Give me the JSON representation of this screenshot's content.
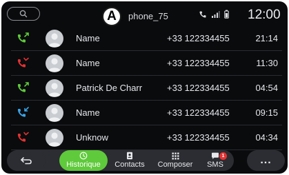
{
  "header": {
    "badge": "A",
    "device_name": "phone_75",
    "time": "12:00"
  },
  "calls": [
    {
      "type": "outgoing",
      "name": "Name",
      "number": "+33 122334455",
      "time": "21:14"
    },
    {
      "type": "missed",
      "name": "Name",
      "number": "+33 122334455",
      "time": "11:30"
    },
    {
      "type": "outgoing",
      "name": "Patrick De Charr",
      "number": "+33 122334455",
      "time": "04:54"
    },
    {
      "type": "incoming",
      "name": "Name",
      "number": "+33 122334455",
      "time": "09:15"
    },
    {
      "type": "missed",
      "name": "Unknow",
      "number": "+33 122334455",
      "time": "04:34"
    }
  ],
  "call_type_colors": {
    "outgoing": "#5fca3b",
    "missed": "#e53232",
    "incoming": "#3aa3e6"
  },
  "nav": {
    "tabs": [
      {
        "label": "Historique",
        "icon": "clock-icon",
        "active": true
      },
      {
        "label": "Contacts",
        "icon": "contacts-book-icon",
        "active": false
      },
      {
        "label": "Composer",
        "icon": "dialpad-icon",
        "active": false
      },
      {
        "label": "SMS",
        "icon": "sms-bubble-icon",
        "active": false
      }
    ],
    "sms_badge": "1",
    "more_label": "...",
    "accent": "#5fca3b"
  }
}
